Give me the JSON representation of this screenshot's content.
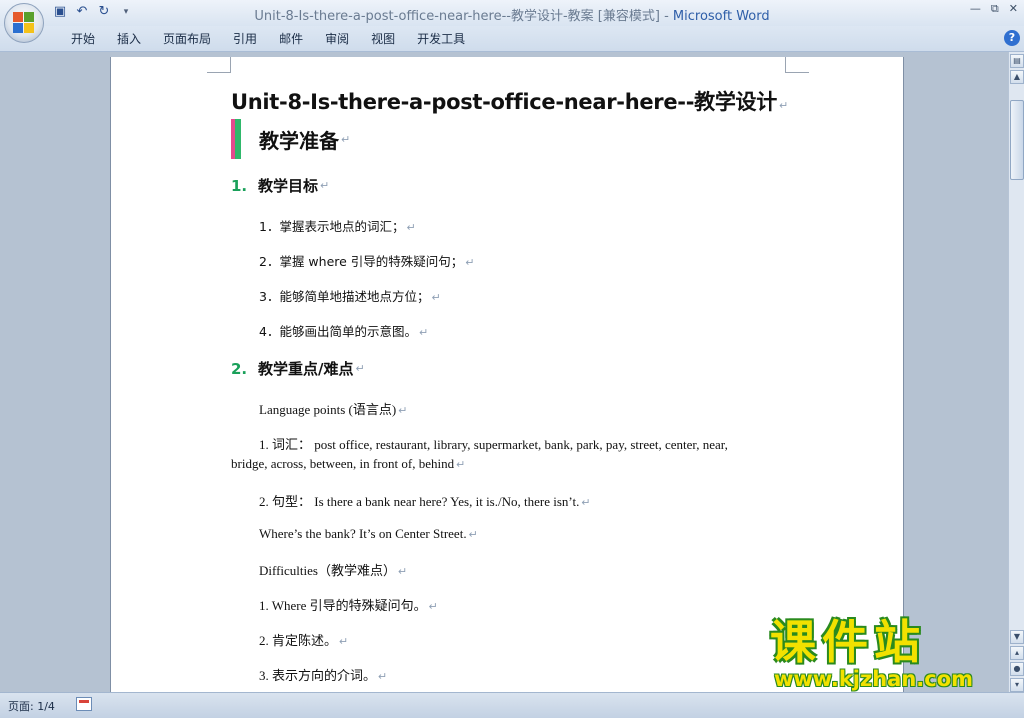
{
  "window": {
    "title_doc": "Unit-8-Is-there-a-post-office-near-here--教学设计-教案 [兼容模式] - ",
    "title_app": "Microsoft Word"
  },
  "ribbon": {
    "tabs": [
      "开始",
      "插入",
      "页面布局",
      "引用",
      "邮件",
      "审阅",
      "视图",
      "开发工具"
    ],
    "help": "?"
  },
  "document": {
    "title": "Unit-8-Is-there-a-post-office-near-here--教学设计",
    "heading1": "教学准备",
    "paragraph_mark": "↵",
    "section1": {
      "num": "1.",
      "title": "教学目标"
    },
    "objectives": [
      "1．掌握表示地点的词汇；",
      "2．掌握 where 引导的特殊疑问句；",
      "3．能够简单地描述地点方位；",
      "4．能够画出简单的示意图。"
    ],
    "section2": {
      "num": "2.",
      "title": "教学重点/难点"
    },
    "language_points": "Language points (语言点)",
    "vocab_line1": "1. 词汇： post office, restaurant, library, supermarket, bank, park, pay, street, center, near,",
    "vocab_line2": "bridge, across, between, in front of, behind",
    "sentence1": "2. 句型： Is there a bank near here? Yes, it is./No, there isn’t.",
    "sentence2": "Where’s the bank? It’s on Center Street.",
    "difficulties": "Difficulties（教学难点）",
    "diff1": "1. Where 引导的特殊疑问句。",
    "diff2": "2. 肯定陈述。",
    "diff3": "3. 表示方向的介词。"
  },
  "statusbar": {
    "page": "页面: 1/4"
  },
  "watermark": {
    "title": "课件站",
    "url": "www.kjzhan.com"
  },
  "colors": {
    "section_number": "#1aa05a",
    "heading_bar_pink": "#e44a8e",
    "heading_bar_green": "#2fb86b",
    "watermark_yellow": "#f2e100"
  }
}
